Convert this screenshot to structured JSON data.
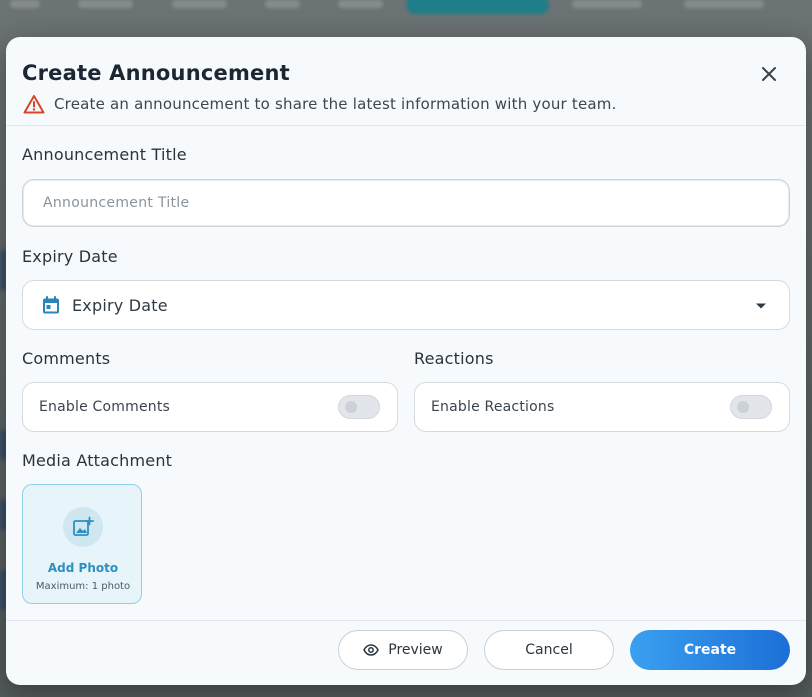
{
  "modal": {
    "title": "Create Announcement",
    "subtitle": "Create an announcement to share the latest information with your team."
  },
  "form": {
    "title_label": "Announcement Title",
    "title_placeholder": "Announcement Title",
    "title_value": "",
    "expiry_label": "Expiry Date",
    "expiry_value": "Expiry Date",
    "comments_label": "Comments",
    "comments_toggle_label": "Enable Comments",
    "comments_enabled": false,
    "reactions_label": "Reactions",
    "reactions_toggle_label": "Enable Reactions",
    "reactions_enabled": false,
    "media_label": "Media Attachment",
    "add_photo_label": "Add Photo",
    "add_photo_hint": "Maximum: 1 photo"
  },
  "footer": {
    "preview_label": "Preview",
    "cancel_label": "Cancel",
    "create_label": "Create"
  },
  "icons": {
    "close": "close-icon",
    "warning": "warning-icon",
    "calendar": "calendar-icon",
    "caret": "caret-down-icon",
    "add_photo": "add-photo-icon",
    "eye": "eye-icon"
  },
  "colors": {
    "accent": "#2e8fc0",
    "primary_button": "#1d6fd6",
    "warning": "#d9452a",
    "calendar": "#2a86b8"
  }
}
